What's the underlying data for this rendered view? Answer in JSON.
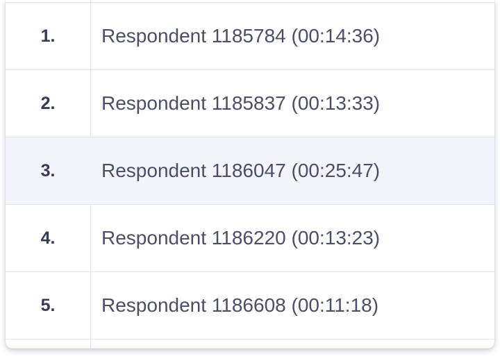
{
  "list": {
    "rows": [
      {
        "index": "1.",
        "label": "Respondent 1185784 (00:14:36)"
      },
      {
        "index": "2.",
        "label": "Respondent 1185837 (00:13:33)"
      },
      {
        "index": "3.",
        "label": "Respondent 1186047 (00:25:47)"
      },
      {
        "index": "4.",
        "label": "Respondent 1186220 (00:13:23)"
      },
      {
        "index": "5.",
        "label": "Respondent 1186608 (00:11:18)"
      }
    ],
    "highlight_color": "#f4f5fc",
    "divider_color": "#e3e4ea",
    "text_color": "#4a4e66",
    "index_color": "#363a56"
  }
}
